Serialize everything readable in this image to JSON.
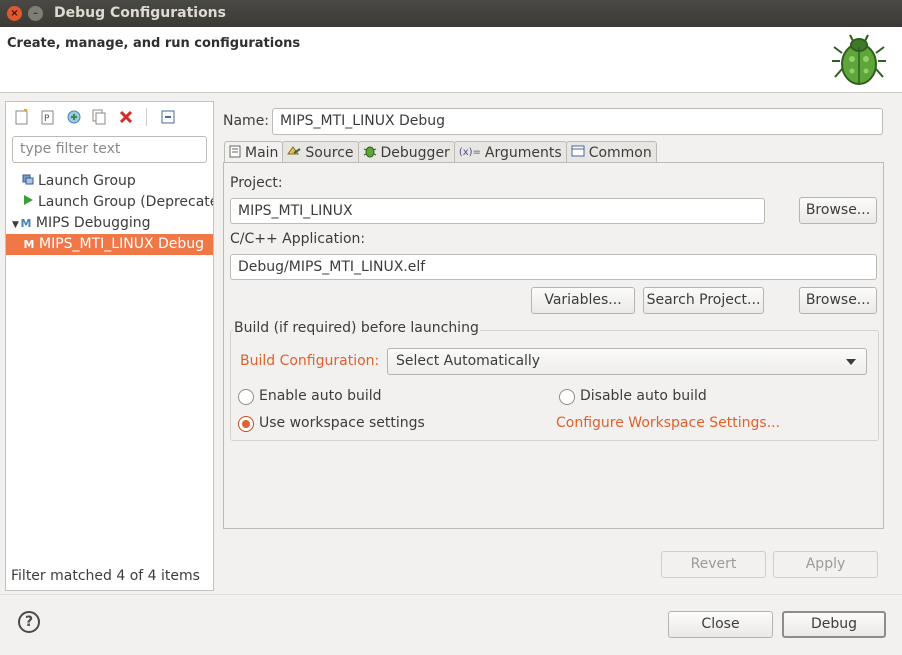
{
  "window": {
    "title": "Debug Configurations",
    "header_title": "Create, manage, and run configurations"
  },
  "left": {
    "filter_placeholder": "type filter text",
    "tree": [
      {
        "label": "Launch Group",
        "icon": "launch-group-icon",
        "level": 1,
        "selected": false
      },
      {
        "label": "Launch Group (Deprecated)",
        "icon": "launch-group-deprecated-icon",
        "level": 1,
        "selected": false
      },
      {
        "label": "MIPS Debugging",
        "icon": "mips-debugging-icon",
        "level": 0,
        "selected": false
      },
      {
        "label": "MIPS_MTI_LINUX Debug",
        "icon": "mips-config-icon",
        "level": 2,
        "selected": true
      }
    ],
    "status": "Filter matched 4 of 4 items"
  },
  "right": {
    "name_label": "Name:",
    "name_value": "MIPS_MTI_LINUX Debug",
    "tabs": [
      {
        "label": "Main",
        "icon": "main-tab-icon",
        "active": true
      },
      {
        "label": "Source",
        "icon": "source-tab-icon",
        "active": false
      },
      {
        "label": "Debugger",
        "icon": "debugger-tab-icon",
        "active": false
      },
      {
        "label": "Arguments",
        "icon": "arguments-tab-icon",
        "active": false
      },
      {
        "label": "Common",
        "icon": "common-tab-icon",
        "active": false
      }
    ],
    "project_label": "Project:",
    "project_value": "MIPS_MTI_LINUX",
    "browse_label": "Browse...",
    "app_label": "C/C++ Application:",
    "app_value": "Debug/MIPS_MTI_LINUX.elf",
    "variables_label": "Variables...",
    "search_project_label": "Search Project...",
    "browse2_label": "Browse...",
    "build_group_title": "Build (if required) before launching",
    "build_config_label": "Build Configuration:",
    "build_config_value": "Select Automatically",
    "enable_auto_build": "Enable auto build",
    "disable_auto_build": "Disable auto build",
    "use_workspace": "Use workspace settings",
    "configure_workspace_link": "Configure Workspace Settings...",
    "selected_radio": "use_workspace"
  },
  "footer": {
    "revert_label": "Revert",
    "apply_label": "Apply",
    "close_label": "Close",
    "debug_label": "Debug"
  },
  "colors": {
    "accent": "#f07746",
    "link": "#e0612d"
  }
}
